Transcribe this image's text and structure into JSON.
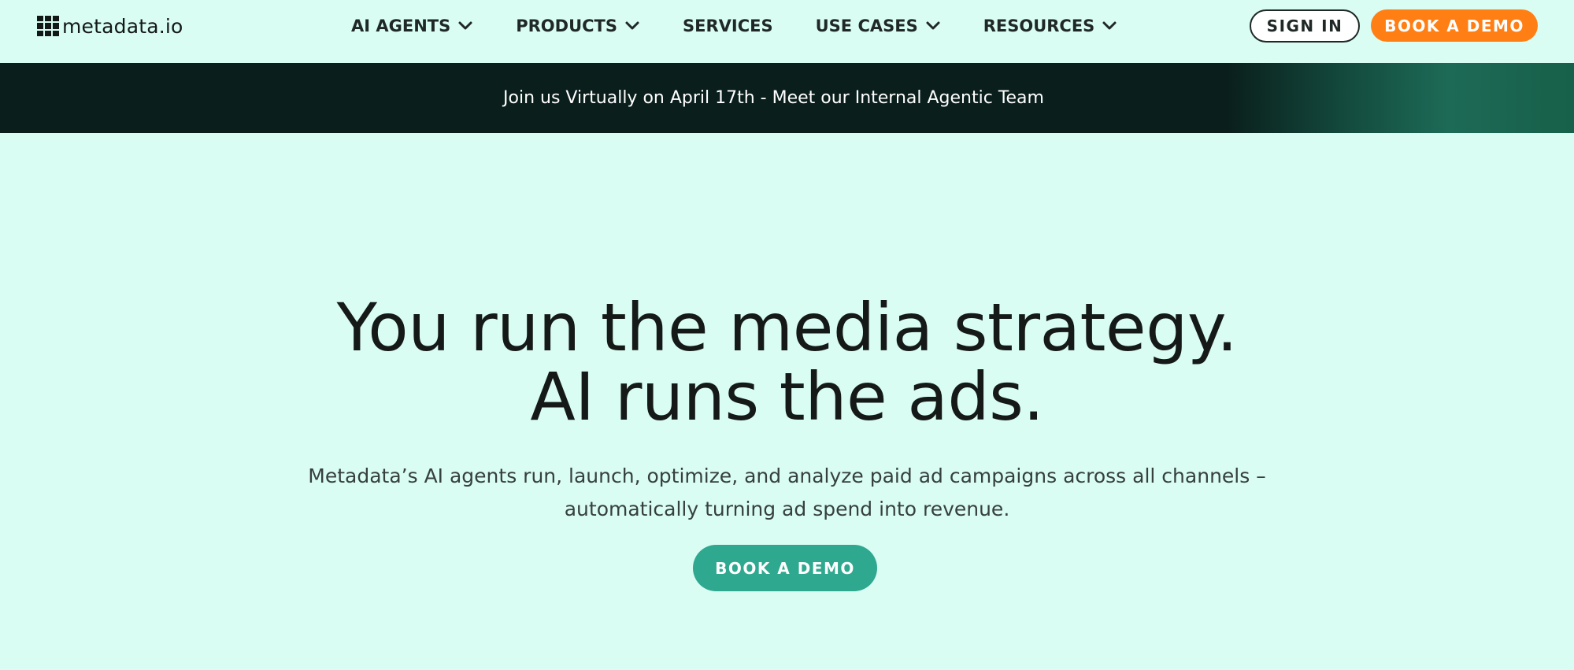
{
  "header": {
    "logo_text": "metadata.io",
    "nav": [
      {
        "label": "AI AGENTS",
        "icon": "chevron-down-icon"
      },
      {
        "label": "PRODUCTS",
        "icon": "chevron-down-icon"
      },
      {
        "label": "SERVICES"
      },
      {
        "label": "USE CASES",
        "icon": "chevron-down-icon"
      },
      {
        "label": "RESOURCES",
        "icon": "chevron-down-icon"
      }
    ],
    "sign_in_label": "SIGN IN",
    "book_demo_label": "BOOK A DEMO"
  },
  "banner": {
    "text": "Join us Virtually on April 17th - Meet our Internal Agentic Team"
  },
  "hero": {
    "title_line_1": "You run the media strategy.",
    "title_line_2": "AI runs the ads.",
    "subtitle_line_1": "Metadata’s AI agents run, launch, optimize, and analyze paid ad campaigns across all channels –",
    "subtitle_line_2": "automatically turning ad spend into revenue.",
    "cta_label": "BOOK A DEMO"
  },
  "colors": {
    "page_background": "#d9fcf3",
    "banner_background": "#0a1f1c",
    "accent_orange": "#ff7f14",
    "accent_teal": "#2ea88e",
    "text_dark": "#151a18"
  }
}
